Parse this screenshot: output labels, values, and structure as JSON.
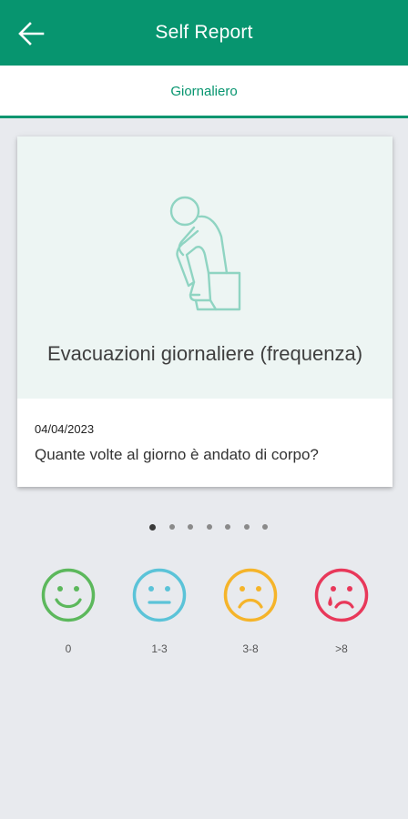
{
  "header": {
    "title": "Self Report",
    "back_icon": "arrow-left-icon"
  },
  "tabs": [
    {
      "label": "Giornaliero",
      "active": true
    }
  ],
  "card": {
    "illustration": "person-on-toilet-icon",
    "title": "Evacuazioni giornaliere (frequenza)",
    "date": "04/04/2023",
    "question": "Quante volte al giorno è andato di corpo?"
  },
  "pager": {
    "count": 7,
    "active_index": 0
  },
  "options": [
    {
      "label": "0",
      "icon": "happy-face-icon",
      "color": "#5cb85c"
    },
    {
      "label": "1-3",
      "icon": "neutral-face-icon",
      "color": "#5bc3d8"
    },
    {
      "label": "3-8",
      "icon": "sad-face-icon",
      "color": "#f5b42a"
    },
    {
      "label": ">8",
      "icon": "crying-face-icon",
      "color": "#e8385a"
    }
  ],
  "colors": {
    "primary": "#07956f",
    "card_top": "#edf5f3",
    "background": "#e8eaee"
  }
}
